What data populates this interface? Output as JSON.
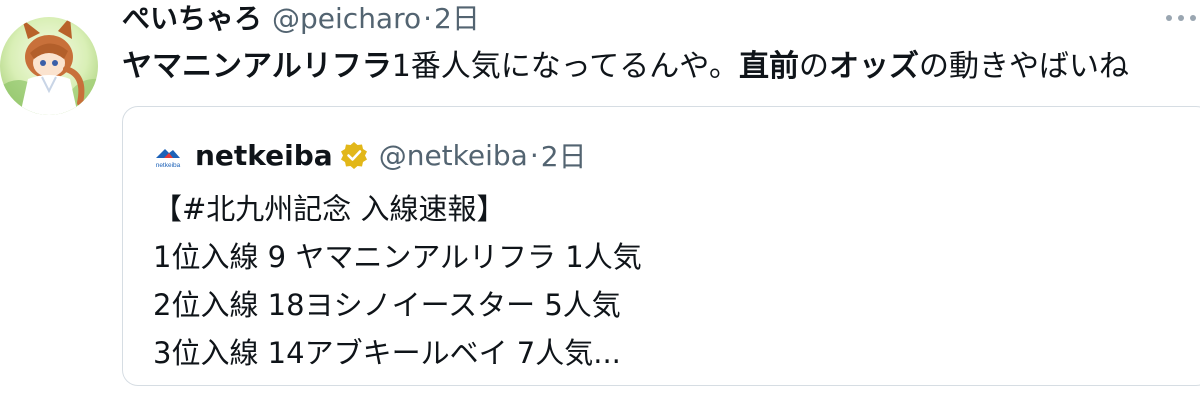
{
  "tweet": {
    "display_name": "ぺいちゃろ",
    "handle": "@peicharo",
    "separator": "·",
    "time": "2日",
    "body": {
      "horse_name": "ヤマニンアルリフラ",
      "text_a": "1番人気になってるんや。",
      "emph_1": "直前",
      "text_b": "の",
      "emph_2": "オッズ",
      "text_c": "の動きやばいね"
    },
    "more_icon": "more-dots-icon"
  },
  "quoted": {
    "logo_text": "netkeiba",
    "display_name": "netkeiba",
    "verified": true,
    "badge_color": "#e2b719",
    "handle": "@netkeiba",
    "separator": "·",
    "time": "2日",
    "lines": [
      "【#北九州記念 入線速報】",
      "1位入線 9 ヤマニンアルリフラ 1人気",
      "2位入線 18ヨシノイースター 5人気",
      "3位入線 14アブキールベイ 7人気..."
    ]
  }
}
